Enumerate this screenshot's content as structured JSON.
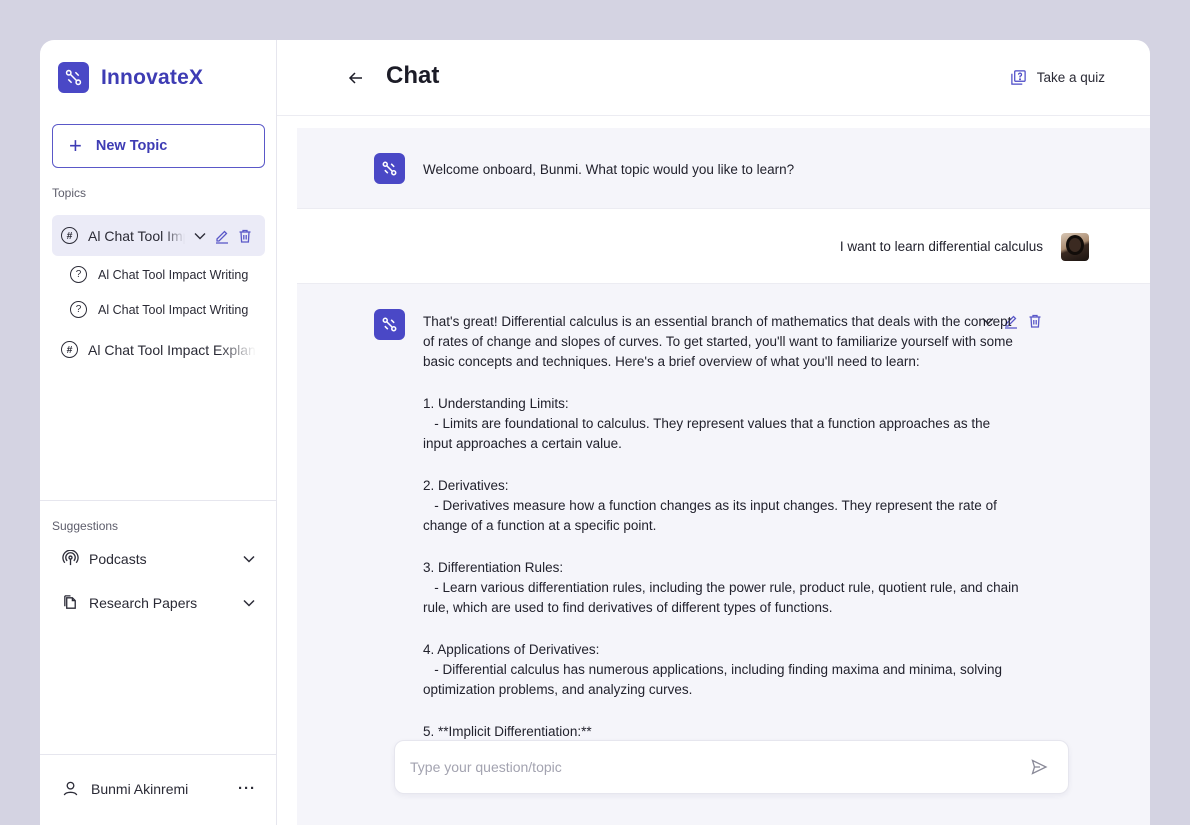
{
  "brand": {
    "name": "InnovateX"
  },
  "sidebar": {
    "new_topic_label": "New Topic",
    "topics_label": "Topics",
    "topics": [
      {
        "label": "Al Chat Tool Impact Writing",
        "active": true,
        "children": [
          "Al Chat Tool Impact Writing",
          "Al Chat Tool Impact Writing"
        ]
      },
      {
        "label": "Al Chat Tool Impact Explanation",
        "active": false
      }
    ],
    "suggestions_label": "Suggestions",
    "suggestions": [
      {
        "label": "Podcasts",
        "icon": "podcast-icon"
      },
      {
        "label": "Research Papers",
        "icon": "papers-icon"
      }
    ],
    "user": {
      "name": "Bunmi Akinremi",
      "more": "···"
    }
  },
  "header": {
    "title": "Chat",
    "quiz_label": "Take a quiz"
  },
  "chat": {
    "welcome": "Welcome onboard, Bunmi. What topic would you like to learn?",
    "user_message": "I want to learn differential calculus",
    "response": {
      "intro": "That's great! Differential calculus is an essential branch of mathematics that deals with the concept of rates of change and slopes of curves. To get started, you'll want to familiarize yourself with some basic concepts and techniques. Here's a brief overview of what you'll need to learn:",
      "items": [
        {
          "heading": "1. Understanding Limits:",
          "body": "   - Limits are foundational to calculus. They represent values that a function approaches as the input approaches a certain value."
        },
        {
          "heading": "2. Derivatives:",
          "body": "   - Derivatives measure how a function changes as its input changes. They represent the rate of change of a function at a specific point."
        },
        {
          "heading": "3. Differentiation Rules:",
          "body": "   - Learn various differentiation rules, including the power rule, product rule, quotient rule, and chain rule, which are used to find derivatives of different types of functions."
        },
        {
          "heading": "4. Applications of Derivatives:",
          "body": "   - Differential calculus has numerous applications, including finding maxima and minima, solving optimization problems, and analyzing curves."
        },
        {
          "heading": "5. **Implicit Differentiation:**",
          "body": ""
        }
      ]
    }
  },
  "input": {
    "placeholder": "Type your question/topic"
  },
  "colors": {
    "accent": "#4a48c6",
    "background": "#d4d3e2",
    "bubble": "#f5f5fa"
  }
}
